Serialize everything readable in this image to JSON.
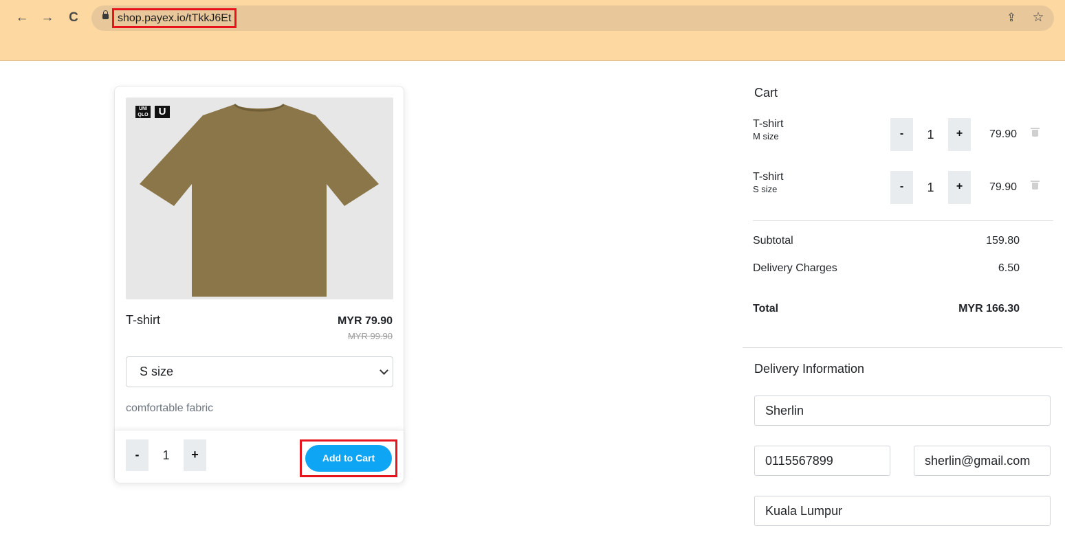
{
  "browser": {
    "url": "shop.payex.io/tTkkJ6Et",
    "back_icon": "←",
    "forward_icon": "→",
    "reload_icon": "C",
    "share_icon": "⇪",
    "star_icon": "☆"
  },
  "product": {
    "brand_logo": [
      "UNI QLO",
      "U"
    ],
    "name": "T-shirt",
    "price": "MYR 79.90",
    "original_price": "MYR 99.90",
    "selected_size": "S size",
    "description": "comfortable fabric",
    "quantity": "1",
    "minus": "-",
    "plus": "+",
    "add_to_cart": "Add to Cart",
    "image_color": "#8a7648"
  },
  "cart": {
    "title": "Cart",
    "items": [
      {
        "name": "T-shirt",
        "variant": "M size",
        "quantity": "1",
        "price": "79.90",
        "minus": "-",
        "plus": "+"
      },
      {
        "name": "T-shirt",
        "variant": "S size",
        "quantity": "1",
        "price": "79.90",
        "minus": "-",
        "plus": "+"
      }
    ],
    "subtotal_label": "Subtotal",
    "subtotal": "159.80",
    "delivery_label": "Delivery Charges",
    "delivery": "6.50",
    "total_label": "Total",
    "total": "MYR 166.30"
  },
  "delivery": {
    "title": "Delivery Information",
    "name": "Sherlin",
    "phone": "0115567899",
    "email": "sherlin@gmail.com",
    "address": "Kuala Lumpur"
  },
  "colors": {
    "chrome_bg": "#fdd8a0",
    "accent_button": "#0ea5f5",
    "highlight_box": "#e8141c"
  }
}
